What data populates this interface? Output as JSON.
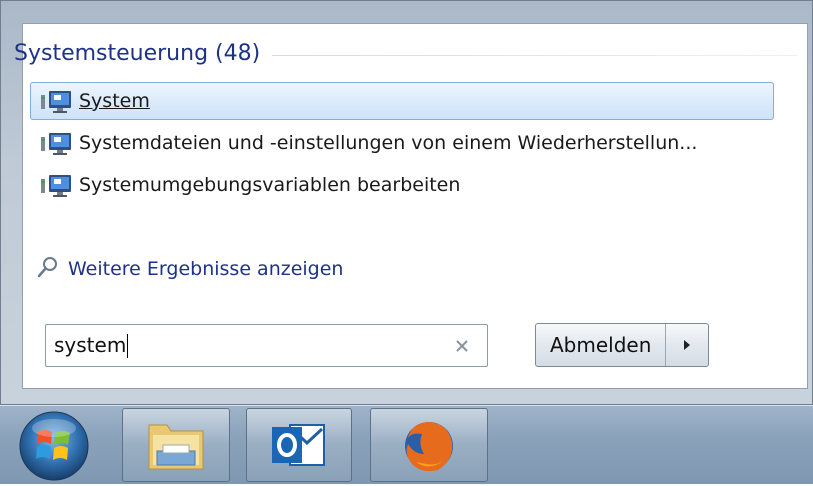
{
  "search_results": {
    "group_title": "Systemsteuerung (48)",
    "items": [
      {
        "label": "System",
        "icon": "system-monitor-icon",
        "selected": true
      },
      {
        "label": "Systemdateien und -einstellungen von einem Wiederherstellun...",
        "icon": "system-monitor-icon",
        "selected": false
      },
      {
        "label": "Systemumgebungsvariablen bearbeiten",
        "icon": "system-monitor-icon",
        "selected": false
      }
    ],
    "more_results_label": "Weitere Ergebnisse anzeigen"
  },
  "search": {
    "value": "system",
    "clear_icon": "clear-x-icon"
  },
  "shutdown": {
    "label": "Abmelden",
    "arrow_icon": "right-arrow-icon"
  },
  "taskbar": {
    "items": [
      {
        "name": "windows-start-orb",
        "icon": "windows-logo-icon"
      },
      {
        "name": "file-explorer",
        "icon": "folder-icon"
      },
      {
        "name": "outlook",
        "icon": "outlook-icon"
      },
      {
        "name": "firefox",
        "icon": "firefox-icon"
      }
    ]
  },
  "colors": {
    "link_blue": "#1e3287",
    "selection_border": "#84acdd"
  }
}
